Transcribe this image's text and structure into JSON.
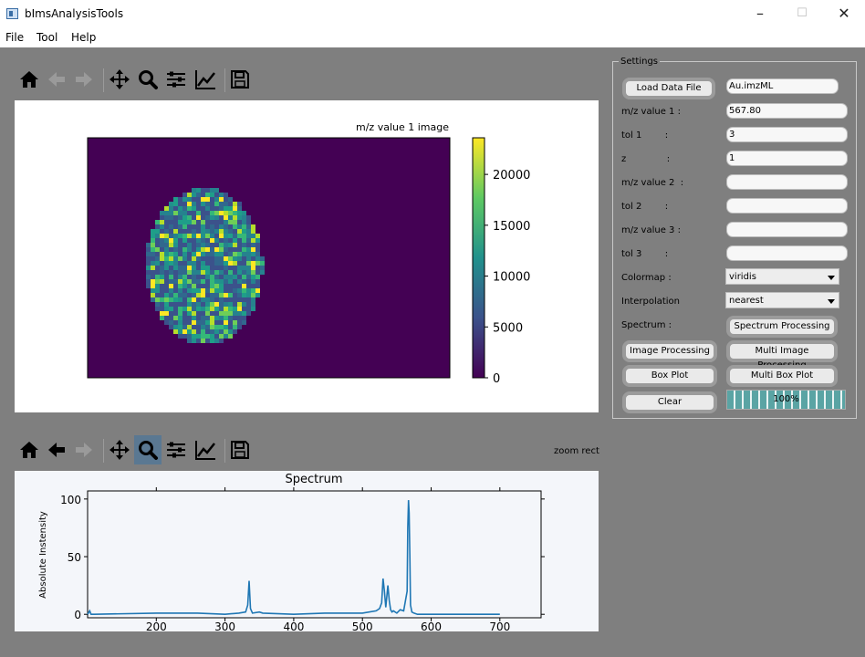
{
  "window": {
    "title": "bImsAnalysisTools",
    "controls": [
      "–",
      "☐",
      "✕"
    ]
  },
  "menu": [
    "File",
    "Tool",
    "Help"
  ],
  "toolbar_top": {
    "icons": [
      "home-icon",
      "back-icon",
      "forward-icon",
      "pan-icon",
      "zoom-icon",
      "subplots-icon",
      "edit-curves-icon",
      "save-icon"
    ],
    "active": null
  },
  "toolbar_bottom": {
    "icons": [
      "home-icon",
      "back-icon",
      "forward-icon",
      "pan-icon",
      "zoom-icon",
      "subplots-icon",
      "edit-curves-icon",
      "save-icon"
    ],
    "active": "zoom-icon",
    "mode_label": "zoom rect"
  },
  "image_plot": {
    "title": "m/z value 1 image",
    "colorbar_ticks": [
      "0",
      "5000",
      "10000",
      "15000",
      "20000"
    ],
    "colormap": "viridis"
  },
  "chart_data": {
    "type": "line",
    "title": "Spectrum",
    "xlabel": "",
    "ylabel": "Absolute Instensity",
    "xlim": [
      100,
      760
    ],
    "ylim": [
      -3,
      107
    ],
    "xticks": [
      200,
      300,
      400,
      500,
      600,
      700
    ],
    "yticks": [
      0,
      50,
      100
    ],
    "series": [
      {
        "color": "#1f77b4",
        "x": [
          100,
          103,
          105,
          110,
          200,
          246,
          260,
          300,
          320,
          330,
          333,
          335,
          337,
          340,
          350,
          355,
          400,
          445,
          500,
          520,
          525,
          528,
          530,
          532,
          534,
          537,
          539,
          541,
          543,
          545,
          550,
          555,
          560,
          565,
          566,
          567,
          568,
          569,
          570,
          572,
          575,
          580,
          600,
          650,
          700
        ],
        "y": [
          0,
          3,
          0,
          0,
          1,
          1,
          1,
          0,
          1,
          2,
          8,
          29,
          5,
          1,
          2,
          1,
          0,
          1,
          1,
          3,
          5,
          10,
          31,
          20,
          6,
          25,
          12,
          4,
          2,
          3,
          1,
          4,
          3,
          20,
          75,
          99,
          88,
          50,
          8,
          2,
          1,
          0,
          0,
          0,
          0
        ]
      }
    ]
  },
  "settings": {
    "group_title": "Settings",
    "load_button": "Load Data File",
    "file_name": "Au.imzML",
    "fields": [
      {
        "label": "m/z value 1 :",
        "value": "567.80"
      },
      {
        "label": "tol 1        :",
        "value": "3"
      },
      {
        "label": "z              :",
        "value": "1"
      },
      {
        "label": "m/z value 2  :",
        "value": ""
      },
      {
        "label": "tol 2        :",
        "value": ""
      },
      {
        "label": "m/z value 3 :",
        "value": ""
      },
      {
        "label": "tol 3        :",
        "value": ""
      }
    ],
    "colormap_label": "Colormap :",
    "colormap_value": "viridis",
    "interp_label": "Interpolation",
    "interp_value": "nearest",
    "spectrum_label": "Spectrum :",
    "spectrum_button": "Spectrum Processing",
    "image_proc_button": "Image Processing",
    "multi_image_button": "Multi Image Processing",
    "box_plot_button": "Box Plot",
    "multi_box_button": "Multi Box Plot",
    "clear_button": "Clear",
    "progress": "100%",
    "progress_value": 1.0
  }
}
